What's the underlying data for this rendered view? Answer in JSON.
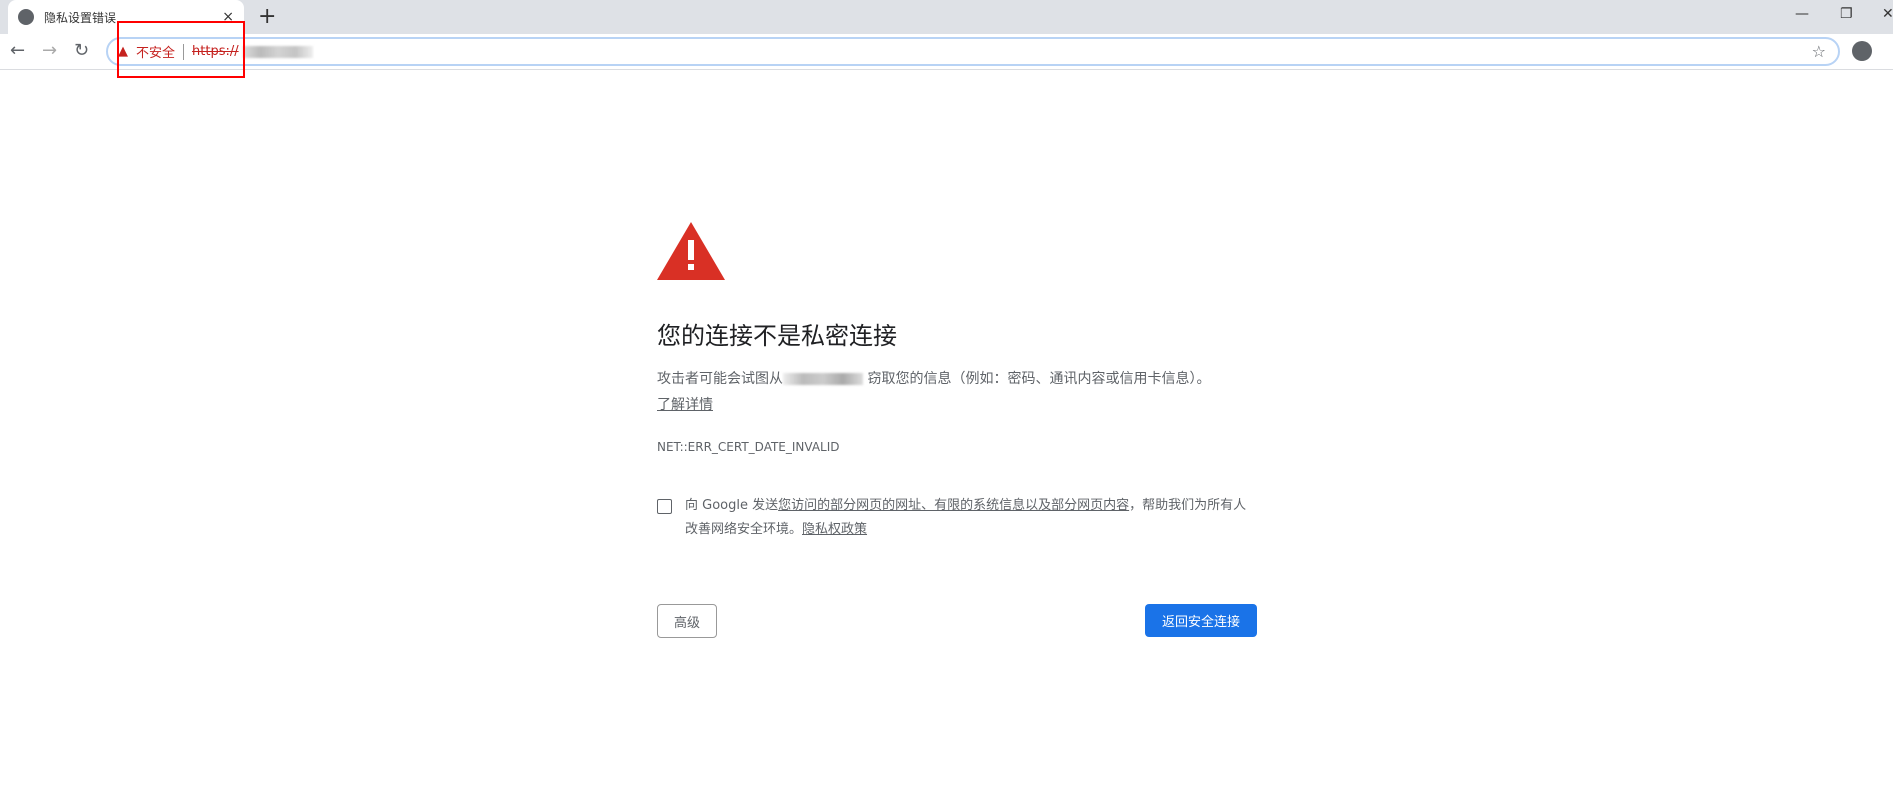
{
  "tab": {
    "title": "隐私设置错误",
    "close": "×",
    "new_tab": "+"
  },
  "window": {
    "minimize": "—",
    "restore": "❐",
    "close": "✕"
  },
  "toolbar": {
    "back": "←",
    "forward": "→",
    "reload": "↻",
    "security_label": "不安全",
    "url_scheme": "https://",
    "star": "☆"
  },
  "page": {
    "heading": "您的连接不是私密连接",
    "desc_before": "攻击者可能会试图从",
    "desc_after": " 窃取您的信息（例如：密码、通讯内容或信用卡信息）。",
    "learn_more": "了解详情",
    "error_code": "NET::ERR_CERT_DATE_INVALID",
    "checkbox_prefix": "向 Google 发送",
    "checkbox_link": "您访问的部分网页的网址、有限的系统信息以及部分网页内容",
    "checkbox_suffix": "，帮助我们为所有人改善网络安全环境。",
    "privacy_link": "隐私权政策",
    "advanced_button": "高级",
    "back_button": "返回安全连接"
  },
  "colors": {
    "accent": "#1a73e8",
    "danger": "#d93025"
  }
}
